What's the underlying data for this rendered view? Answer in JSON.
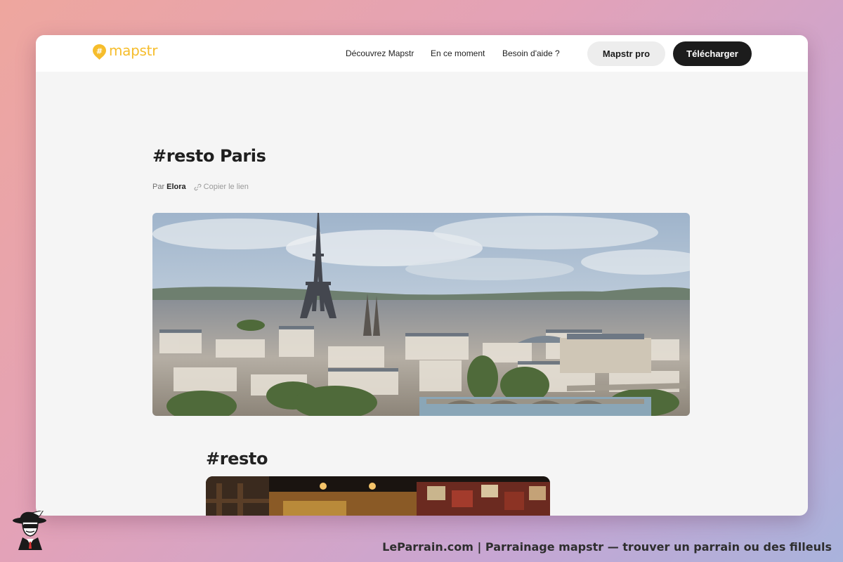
{
  "nav": {
    "logo_text": "mapstr",
    "links": [
      "Découvrez Mapstr",
      "En ce moment",
      "Besoin d'aide ?"
    ],
    "pro_button": "Mapstr pro",
    "download_button": "Télécharger"
  },
  "list": {
    "title": "#resto Paris",
    "by_prefix": "Par",
    "author": "Elora",
    "copy_link": "Copier le lien",
    "hero_image": "paris-skyline-eiffel-tower-photo"
  },
  "section": {
    "title": "#resto",
    "image": "restaurant-interior-photo"
  },
  "footer": {
    "caption": "LeParrain.com | Parrainage mapstr — trouver un parrain ou des filleuls",
    "mascot": "spy-mascot-icon"
  },
  "colors": {
    "brand_yellow": "#f6bd2c",
    "dark_button": "#1c1c1c",
    "light_button": "#ededed",
    "page_bg": "#f5f5f5"
  }
}
